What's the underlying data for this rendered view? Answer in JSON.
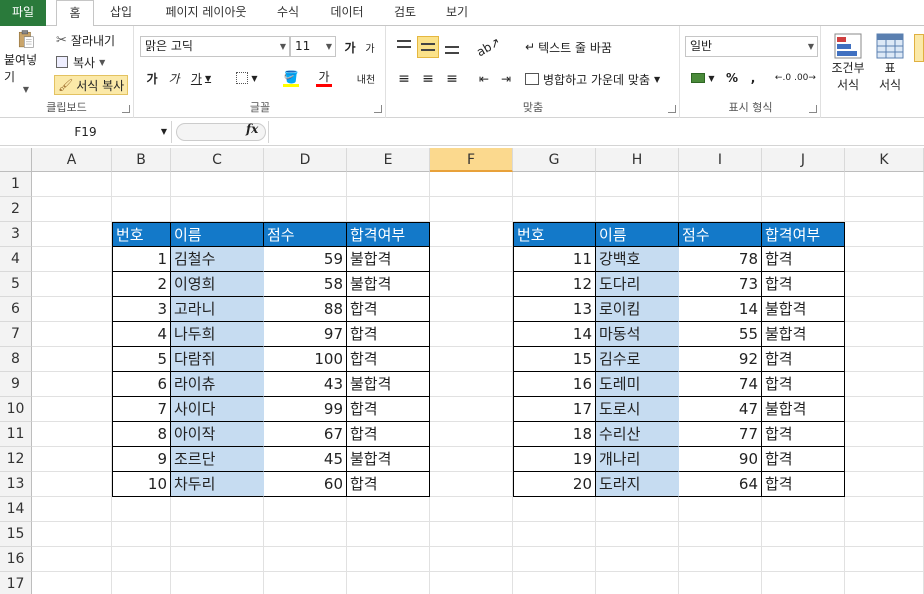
{
  "tabs": [
    "파일",
    "홈",
    "삽입",
    "페이지 레이아웃",
    "수식",
    "데이터",
    "검토",
    "보기"
  ],
  "clipboard": {
    "paste": "붙여넣기",
    "cut": "잘라내기",
    "copy": "복사",
    "format_painter": "서식 복사",
    "label": "클립보드"
  },
  "font": {
    "name": "맑은 고딕",
    "size": "11",
    "grow": "가",
    "shrink": "가",
    "bold": "가",
    "italic": "가",
    "underline": "가",
    "font_color": "가",
    "phonetic": "내천",
    "label": "글꼴"
  },
  "alignment": {
    "wrap_text": "텍스트 줄 바꿈",
    "merge_center": "병합하고 가운데 맞춤",
    "label": "맞춤"
  },
  "number": {
    "format": "일반",
    "percent": "%",
    "comma": ",",
    "label": "표시 형식"
  },
  "styles": {
    "conditional_line1": "조건부",
    "conditional_line2": "서식",
    "table_line1": "표",
    "table_line2": "서식"
  },
  "formula_bar": {
    "name_box": "F19",
    "fx": "fx",
    "value": ""
  },
  "columns": [
    "A",
    "B",
    "C",
    "D",
    "E",
    "F",
    "G",
    "H",
    "I",
    "J",
    "K"
  ],
  "selected_column": "F",
  "rows": [
    "1",
    "2",
    "3",
    "4",
    "5",
    "6",
    "7",
    "8",
    "9",
    "10",
    "11",
    "12",
    "13",
    "14",
    "15",
    "16",
    "17"
  ],
  "table_left": {
    "headers": [
      "번호",
      "이름",
      "점수",
      "합격여부"
    ],
    "rows": [
      [
        "1",
        "김철수",
        "59",
        "불합격"
      ],
      [
        "2",
        "이영희",
        "58",
        "불합격"
      ],
      [
        "3",
        "고라니",
        "88",
        "합격"
      ],
      [
        "4",
        "나두희",
        "97",
        "합격"
      ],
      [
        "5",
        "다람쥐",
        "100",
        "합격"
      ],
      [
        "6",
        "라이츄",
        "43",
        "불합격"
      ],
      [
        "7",
        "사이다",
        "99",
        "합격"
      ],
      [
        "8",
        "아이작",
        "67",
        "합격"
      ],
      [
        "9",
        "조르단",
        "45",
        "불합격"
      ],
      [
        "10",
        "차두리",
        "60",
        "합격"
      ]
    ]
  },
  "table_right": {
    "headers": [
      "번호",
      "이름",
      "점수",
      "합격여부"
    ],
    "rows": [
      [
        "11",
        "강백호",
        "78",
        "합격"
      ],
      [
        "12",
        "도다리",
        "73",
        "합격"
      ],
      [
        "13",
        "로이킴",
        "14",
        "불합격"
      ],
      [
        "14",
        "마동석",
        "55",
        "불합격"
      ],
      [
        "15",
        "김수로",
        "92",
        "합격"
      ],
      [
        "16",
        "도레미",
        "74",
        "합격"
      ],
      [
        "17",
        "도로시",
        "47",
        "불합격"
      ],
      [
        "18",
        "수리산",
        "77",
        "합격"
      ],
      [
        "19",
        "개나리",
        "90",
        "합격"
      ],
      [
        "20",
        "도라지",
        "64",
        "합격"
      ]
    ]
  },
  "colors": {
    "file_tab": "#2a7a3b",
    "header_fill": "#1379c9",
    "name_fill": "#c6dcf1",
    "selected_col": "#fbd98e"
  }
}
